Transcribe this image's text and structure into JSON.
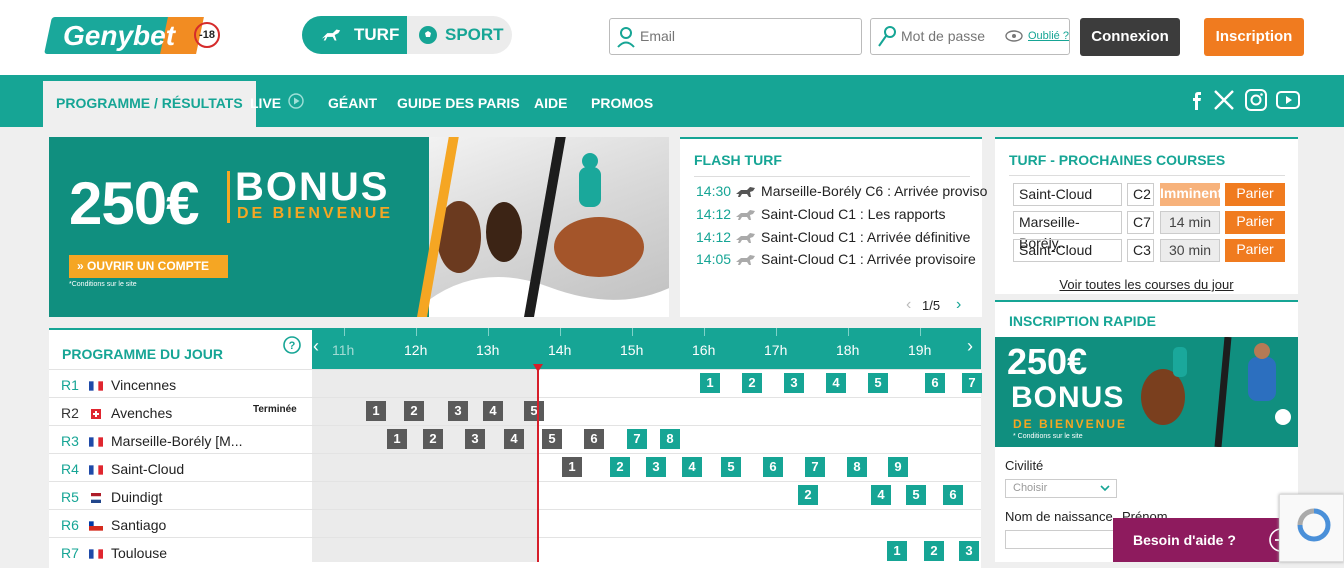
{
  "header": {
    "logo": "Genybet",
    "age_badge": "-18",
    "switch": {
      "turf": "TURF",
      "sport": "SPORT"
    },
    "email_placeholder": "Email",
    "password_placeholder": "Mot de passe",
    "forgot": "Oublié ?",
    "login": "Connexion",
    "signup": "Inscription"
  },
  "nav": {
    "items": [
      "PROGRAMME / RÉSULTATS",
      "LIVE",
      "GÉANT",
      "GUIDE DES PARIS",
      "AIDE",
      "PROMOS"
    ]
  },
  "banner": {
    "amount": "250€",
    "bonus": "BONUS",
    "subtitle": "DE BIENVENUE",
    "cta": "» OUVRIR UN COMPTE",
    "conditions": "*Conditions sur le site"
  },
  "flash": {
    "title": "FLASH TURF",
    "items": [
      {
        "time": "14:30",
        "text": "Marseille-Borély C6 : Arrivée proviso"
      },
      {
        "time": "14:12",
        "text": "Saint-Cloud C1 : Les rapports"
      },
      {
        "time": "14:12",
        "text": "Saint-Cloud C1 : Arrivée définitive"
      },
      {
        "time": "14:05",
        "text": "Saint-Cloud C1 : Arrivée provisoire"
      }
    ],
    "pager": "1/5"
  },
  "next_races": {
    "title": "TURF - PROCHAINES COURSES",
    "rows": [
      {
        "venue": "Saint-Cloud",
        "race": "C2",
        "status": "Imminent",
        "bet": "Parier"
      },
      {
        "venue": "Marseille-Borély...",
        "race": "C7",
        "status": "14 min",
        "bet": "Parier"
      },
      {
        "venue": "Saint-Cloud",
        "race": "C3",
        "status": "30 min",
        "bet": "Parier"
      }
    ],
    "all_link": "Voir toutes les courses du jour"
  },
  "quick_signup": {
    "title": "INSCRIPTION RAPIDE",
    "banner_amount": "250€",
    "banner_bonus": "BONUS",
    "banner_sub": "DE BIENVENUE",
    "banner_cond": "* Conditions sur le site",
    "civility_label": "Civilité",
    "civility_placeholder": "Choisir",
    "lastname_label": "Nom de naissance",
    "firstname_label": "Prénom"
  },
  "programme": {
    "title": "PROGRAMME DU JOUR",
    "hours": [
      "11h",
      "12h",
      "13h",
      "14h",
      "15h",
      "16h",
      "17h",
      "18h",
      "19h"
    ],
    "ended_label": "Terminée",
    "meetings": [
      {
        "code": "R1",
        "name": "Vincennes",
        "flag": "FR",
        "races": [
          "1",
          "2",
          "3",
          "4",
          "5",
          "6",
          "7"
        ]
      },
      {
        "code": "R2",
        "name": "Avenches",
        "flag": "CH",
        "races": [
          "1",
          "2",
          "3",
          "4",
          "5"
        ]
      },
      {
        "code": "R3",
        "name": "Marseille-Borély [M...",
        "flag": "FR",
        "races": [
          "1",
          "2",
          "3",
          "4",
          "5",
          "6",
          "7",
          "8"
        ]
      },
      {
        "code": "R4",
        "name": "Saint-Cloud",
        "flag": "FR",
        "races": [
          "1",
          "2",
          "3",
          "4",
          "5",
          "6",
          "7",
          "8",
          "9"
        ]
      },
      {
        "code": "R5",
        "name": "Duindigt",
        "flag": "NL",
        "races": [
          "2",
          "4",
          "5",
          "6"
        ]
      },
      {
        "code": "R6",
        "name": "Santiago",
        "flag": "CL",
        "races": []
      },
      {
        "code": "R7",
        "name": "Toulouse",
        "flag": "FR",
        "races": [
          "1",
          "2",
          "3"
        ]
      }
    ]
  },
  "help_button": "Besoin d'aide ?",
  "colors": {
    "teal": "#16a595",
    "orange": "#f07b1f",
    "dark": "#3c3c3c",
    "done": "#5a5a5a",
    "help": "#8e1b5e"
  }
}
